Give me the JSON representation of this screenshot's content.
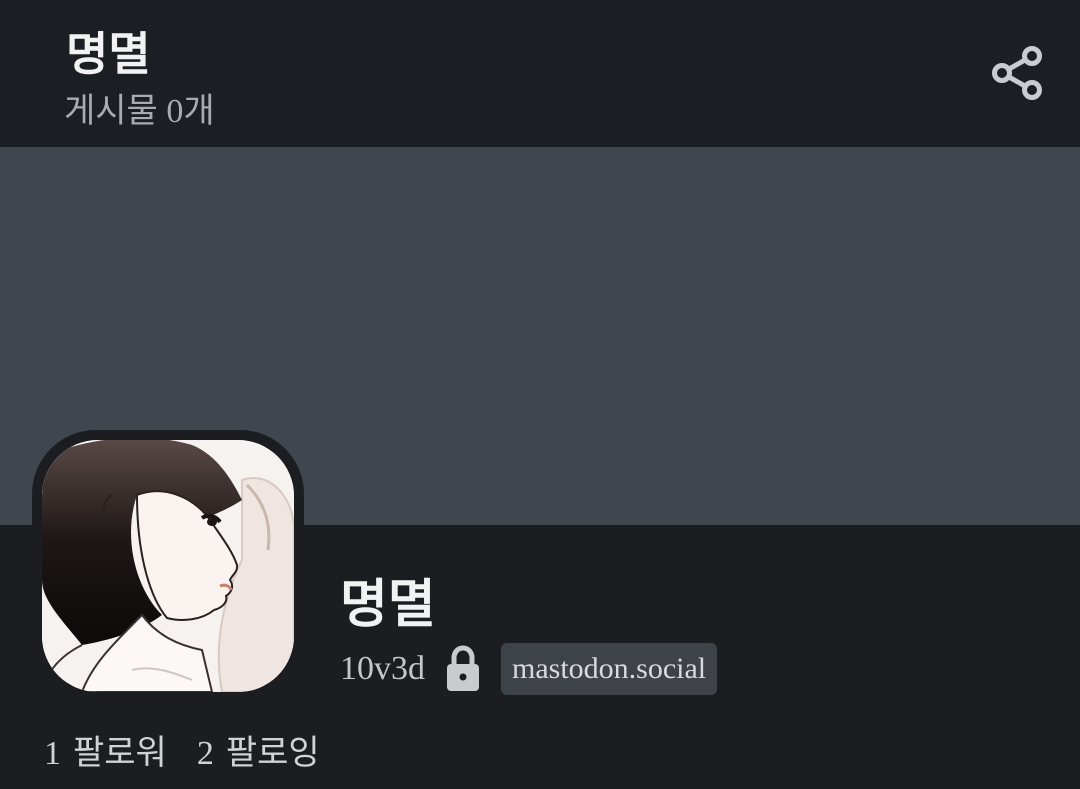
{
  "topbar": {
    "title": "명멸",
    "post_count": "게시물 0개",
    "share_icon": "share-icon"
  },
  "profile": {
    "display_name": "명멸",
    "handle": "10v3d",
    "lock_icon": "lock-icon",
    "domain": "mastodon.social"
  },
  "stats": {
    "followers_count": "1",
    "followers_label": "팔로워",
    "following_count": "2",
    "following_label": "팔로잉"
  },
  "colors": {
    "background": "#1b1d21",
    "banner": "#40464e",
    "badge": "#3e434a"
  }
}
